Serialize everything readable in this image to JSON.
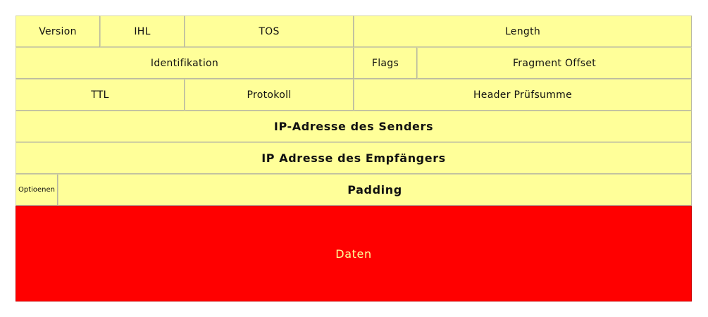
{
  "header": {
    "row1": {
      "version": "Version",
      "ihl": "IHL",
      "tos": "TOS",
      "length": "Length"
    },
    "row2": {
      "identification": "Identifikation",
      "flags": "Flags",
      "fragment_offset": "Fragment Offset"
    },
    "row3": {
      "ttl": "TTL",
      "protocol": "Protokoll",
      "checksum": "Header Prüfsumme"
    },
    "source_address": "IP-Adresse des Senders",
    "destination_address": "IP Adresse des Empfängers",
    "row6": {
      "options": "Optioenen",
      "padding": "Padding"
    }
  },
  "payload": {
    "label": "Daten"
  },
  "colors": {
    "header_fill": "#ffff99",
    "payload_fill": "#ff0000",
    "payload_text": "#ffff99"
  }
}
